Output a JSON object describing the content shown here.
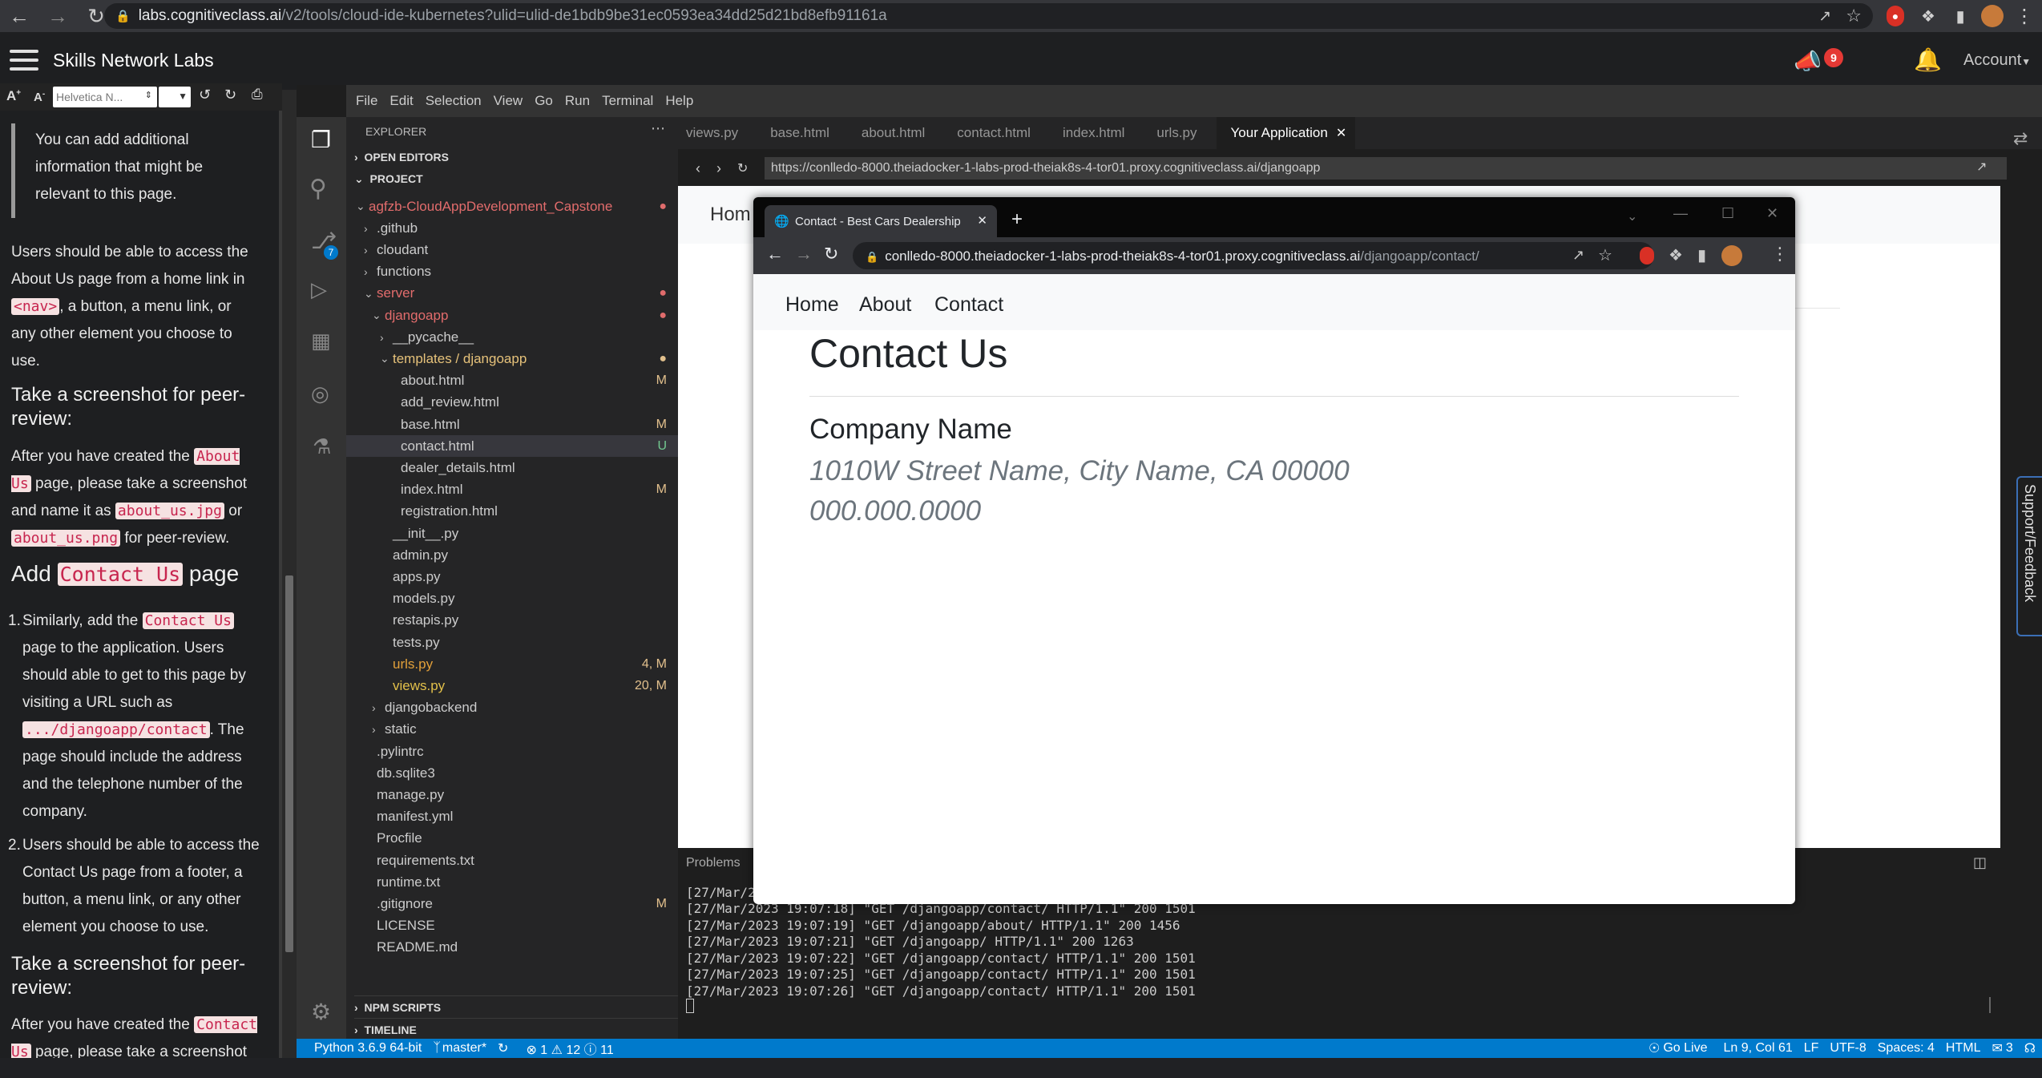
{
  "browser": {
    "url_host": "labs.cognitiveclass.ai",
    "url_path": "/v2/tools/cloud-ide-kubernetes?ulid=ulid-de1bdb9be31ec0593ea34dd25d21bd8efb91161a"
  },
  "header": {
    "title": "Skills Network Labs",
    "badge_count": "9",
    "account_label": "Account"
  },
  "toolbar": {
    "font_select": "Helvetica N..."
  },
  "instructions": {
    "note": "You can add additional information that might be relevant to this page.",
    "p1": "Users should be able to access the About Us page from a home link in",
    "p1_code": "<nav>",
    "p1_tail": ", a button, a menu link, or any other element you choose to use.",
    "h_screenshot": "Take a screenshot for peer-review:",
    "p2_a": "After you have created the",
    "p2_code1": "About Us",
    "p2_b": "page, please take a screenshot and name it as",
    "p2_code2": "about_us.jpg",
    "p2_c": "or",
    "p2_code3": "about_us.png",
    "p2_d": "for peer-review.",
    "h_add_a": "Add",
    "h_add_code": "Contact Us",
    "h_add_b": "page",
    "li1_num": "1.",
    "li1_a": "Similarly, add the",
    "li1_code": "Contact Us",
    "li1_b": "page to the application. Users should able to get to this page by visiting a URL such as",
    "li1_code2": ".../djangoapp/contact",
    "li1_c": ". The page should include the address and the telephone number of the company.",
    "li2_num": "2.",
    "li2": "Users should be able to access the Contact Us page from a footer, a button, a menu link, or any other element you choose to use.",
    "h_screenshot2": "Take a screenshot for peer-review:",
    "p3_a": "After you have created the",
    "p3_code": "Contact Us",
    "p3_b": "page, please take a screenshot"
  },
  "menu": [
    "File",
    "Edit",
    "Selection",
    "View",
    "Go",
    "Run",
    "Terminal",
    "Help"
  ],
  "explorer": {
    "title": "EXPLORER",
    "open_editors": "OPEN EDITORS",
    "project": "PROJECT",
    "npm_scripts": "NPM SCRIPTS",
    "timeline": "TIMELINE",
    "rows": [
      {
        "name": "agfzb-CloudAppDevelopment_Capstone",
        "status": "●"
      },
      {
        "name": ".github",
        "status": ""
      },
      {
        "name": "cloudant",
        "status": ""
      },
      {
        "name": "functions",
        "status": ""
      },
      {
        "name": "server",
        "status": "●"
      },
      {
        "name": "djangoapp",
        "status": "●"
      },
      {
        "name": "__pycache__",
        "status": ""
      },
      {
        "name": "templates / djangoapp",
        "status": "●"
      },
      {
        "name": "about.html",
        "status": "M"
      },
      {
        "name": "add_review.html",
        "status": ""
      },
      {
        "name": "base.html",
        "status": "M"
      },
      {
        "name": "contact.html",
        "status": "U"
      },
      {
        "name": "dealer_details.html",
        "status": ""
      },
      {
        "name": "index.html",
        "status": "M"
      },
      {
        "name": "registration.html",
        "status": ""
      },
      {
        "name": "__init__.py",
        "status": ""
      },
      {
        "name": "admin.py",
        "status": ""
      },
      {
        "name": "apps.py",
        "status": ""
      },
      {
        "name": "models.py",
        "status": ""
      },
      {
        "name": "restapis.py",
        "status": ""
      },
      {
        "name": "tests.py",
        "status": ""
      },
      {
        "name": "urls.py",
        "status": "4, M"
      },
      {
        "name": "views.py",
        "status": "20, M"
      },
      {
        "name": "djangobackend",
        "status": ""
      },
      {
        "name": "static",
        "status": ""
      },
      {
        "name": ".pylintrc",
        "status": ""
      },
      {
        "name": "db.sqlite3",
        "status": ""
      },
      {
        "name": "manage.py",
        "status": ""
      },
      {
        "name": "manifest.yml",
        "status": ""
      },
      {
        "name": "Procfile",
        "status": ""
      },
      {
        "name": "requirements.txt",
        "status": ""
      },
      {
        "name": "runtime.txt",
        "status": ""
      },
      {
        "name": ".gitignore",
        "status": "M"
      },
      {
        "name": "LICENSE",
        "status": ""
      },
      {
        "name": "README.md",
        "status": ""
      }
    ]
  },
  "tabs": [
    "views.py",
    "base.html",
    "about.html",
    "contact.html",
    "index.html",
    "urls.py",
    "Your Application"
  ],
  "preview": {
    "url": "https://conlledo-8000.theiadocker-1-labs-prod-theiak8s-4-tor01.proxy.cognitiveclass.ai/djangoapp",
    "home_partial": "Hom"
  },
  "popup": {
    "tab_title": "Contact - Best Cars Dealership",
    "url_host": "conlledo-8000.theiadocker-1-labs-prod-theiak8s-4-tor01.proxy.cognitiveclass.ai",
    "url_path": "/djangoapp/contact/",
    "nav": [
      "Home",
      "About",
      "Contact"
    ],
    "heading": "Contact Us",
    "company": "Company Name",
    "address": "1010W Street Name, City Name, CA 00000",
    "phone": "000.000.0000"
  },
  "panel": {
    "tab": "Problems",
    "partial_line": "[27/Mar/2",
    "lines": [
      "[27/Mar/2023 19:07:18] \"GET /djangoapp/contact/ HTTP/1.1\" 200 1501",
      "[27/Mar/2023 19:07:19] \"GET /djangoapp/about/ HTTP/1.1\" 200 1456",
      "[27/Mar/2023 19:07:21] \"GET /djangoapp/ HTTP/1.1\" 200 1263",
      "[27/Mar/2023 19:07:22] \"GET /djangoapp/contact/ HTTP/1.1\" 200 1501",
      "[27/Mar/2023 19:07:25] \"GET /djangoapp/contact/ HTTP/1.1\" 200 1501",
      "[27/Mar/2023 19:07:26] \"GET /djangoapp/contact/ HTTP/1.1\" 200 1501"
    ]
  },
  "statusbar": {
    "python": "Python 3.6.9 64-bit",
    "branch": "master*",
    "problems": "⊗ 1 ⚠ 12 ⓘ 11",
    "golive": "Go Live",
    "position": "Ln 9, Col 61",
    "eol": "LF",
    "encoding": "UTF-8",
    "spaces": "Spaces: 4",
    "lang": "HTML",
    "notif": "3"
  },
  "feedback_tab": "Support/Feedback",
  "explorer_badge": "7"
}
